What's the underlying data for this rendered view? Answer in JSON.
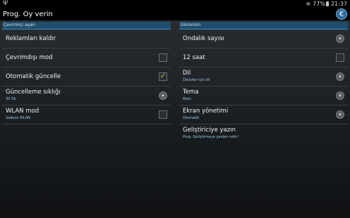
{
  "status_bar": {
    "battery": "77%",
    "time": "21:37"
  },
  "action_bar": {
    "title": "Prog. Oy verin",
    "app_icon_glyph": "€"
  },
  "left_section": {
    "header": "Çevrimiçi ayarı",
    "rows": [
      {
        "title": "Reklamları kaldır",
        "subtitle": "",
        "control": "none"
      },
      {
        "title": "Çevrimdışı mod",
        "subtitle": "",
        "control": "checkbox",
        "checked": false
      },
      {
        "title": "Otomatik güncelle",
        "subtitle": "",
        "control": "checkbox",
        "checked": true
      },
      {
        "title": "Güncelleme sıklığı",
        "subtitle": "30 Dk",
        "control": "dropdown"
      },
      {
        "title": "WLAN mod",
        "subtitle": "Sadece WLAN",
        "control": "checkbox",
        "checked": false
      }
    ]
  },
  "right_section": {
    "header": "Görünüm",
    "rows": [
      {
        "title": "Ondalık sayısı",
        "subtitle": "",
        "control": "dropdown"
      },
      {
        "title": "12 saat",
        "subtitle": "",
        "control": "checkbox",
        "checked": false
      },
      {
        "title": "Dil",
        "subtitle": "Dövizler için dil",
        "control": "dropdown"
      },
      {
        "title": "Tema",
        "subtitle": "Mavi",
        "control": "dropdown"
      },
      {
        "title": "Ekran yönetimi",
        "subtitle": "Otomatik",
        "control": "dropdown"
      },
      {
        "title": "Geliştiriciye yazın",
        "subtitle": "Prog. Geliştirmeye yardım edin!",
        "control": "none"
      }
    ]
  },
  "colors": {
    "accent": "#3c8cc0",
    "check": "#9ad64a",
    "subtitle": "#9ec9e8"
  }
}
